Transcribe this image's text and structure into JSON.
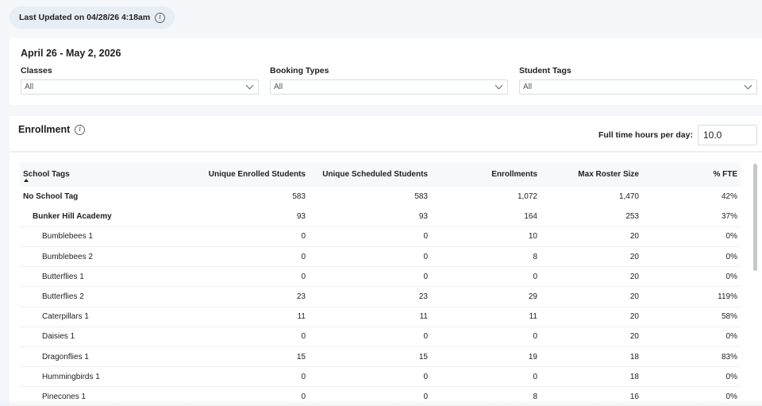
{
  "last_updated": {
    "text": "Last Updated on 04/28/26 4:18am"
  },
  "filters": {
    "date_range": "April 26 - May 2, 2026",
    "classes": {
      "label": "Classes",
      "value": "All"
    },
    "booking_types": {
      "label": "Booking Types",
      "value": "All"
    },
    "student_tags": {
      "label": "Student Tags",
      "value": "All"
    }
  },
  "enrollment": {
    "title": "Enrollment",
    "fte_label": "Full time hours per day:",
    "fte_value": "10.0",
    "columns": [
      "School Tags",
      "Unique Enrolled Students",
      "Unique Scheduled Students",
      "Enrollments",
      "Max Roster Size",
      "% FTE"
    ],
    "rows": [
      {
        "level": 0,
        "name": "No School Tag",
        "enrolled": "583",
        "scheduled": "583",
        "enrollments": "1,072",
        "max_roster": "1,470",
        "fte": "42%"
      },
      {
        "level": 1,
        "name": "Bunker Hill Academy",
        "enrolled": "93",
        "scheduled": "93",
        "enrollments": "164",
        "max_roster": "253",
        "fte": "37%"
      },
      {
        "level": 2,
        "name": "Bumblebees 1",
        "enrolled": "0",
        "scheduled": "0",
        "enrollments": "10",
        "max_roster": "20",
        "fte": "0%"
      },
      {
        "level": 2,
        "name": "Bumblebees 2",
        "enrolled": "0",
        "scheduled": "0",
        "enrollments": "8",
        "max_roster": "20",
        "fte": "0%"
      },
      {
        "level": 2,
        "name": "Butterflies 1",
        "enrolled": "0",
        "scheduled": "0",
        "enrollments": "0",
        "max_roster": "20",
        "fte": "0%"
      },
      {
        "level": 2,
        "name": "Butterflies 2",
        "enrolled": "23",
        "scheduled": "23",
        "enrollments": "29",
        "max_roster": "20",
        "fte": "119%"
      },
      {
        "level": 2,
        "name": "Caterpillars 1",
        "enrolled": "11",
        "scheduled": "11",
        "enrollments": "11",
        "max_roster": "20",
        "fte": "58%"
      },
      {
        "level": 2,
        "name": "Daisies 1",
        "enrolled": "0",
        "scheduled": "0",
        "enrollments": "0",
        "max_roster": "20",
        "fte": "0%"
      },
      {
        "level": 2,
        "name": "Dragonflies 1",
        "enrolled": "15",
        "scheduled": "15",
        "enrollments": "19",
        "max_roster": "18",
        "fte": "83%"
      },
      {
        "level": 2,
        "name": "Hummingbirds 1",
        "enrolled": "0",
        "scheduled": "0",
        "enrollments": "0",
        "max_roster": "18",
        "fte": "0%"
      },
      {
        "level": 2,
        "name": "Pinecones 1",
        "enrolled": "0",
        "scheduled": "0",
        "enrollments": "8",
        "max_roster": "16",
        "fte": "0%"
      }
    ]
  },
  "icons": {
    "info": "info-icon",
    "dropdown": "chevron-down-icon",
    "sort": "sort-ascending-icon"
  }
}
